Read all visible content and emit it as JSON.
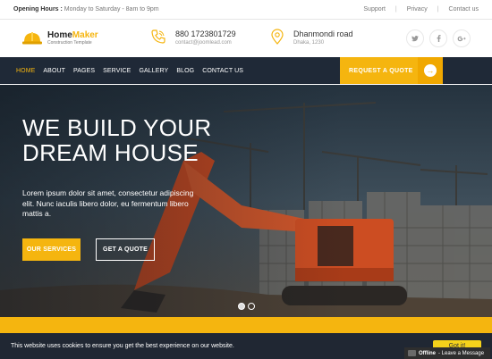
{
  "topbar": {
    "hours_label": "Opening Hours :",
    "hours_value": "Monday to Saturday - 8am to 9pm",
    "links": [
      "Support",
      "Privacy",
      "Contact us"
    ]
  },
  "header": {
    "logo_name_1": "Home",
    "logo_name_2": "Maker",
    "logo_tagline": "Construction Template",
    "phone": "880 1723801729",
    "email": "contact@joomlead.com",
    "address_line1": "Dhanmondi road",
    "address_line2": "Dhaka, 1230",
    "social": [
      "twitter-icon",
      "facebook-icon",
      "google-plus-icon"
    ]
  },
  "nav": {
    "items": [
      "HOME",
      "ABOUT",
      "PAGES",
      "SERVICE",
      "GALLERY",
      "BLOG",
      "CONTACT US"
    ],
    "cta": "REQUEST A QUOTE"
  },
  "hero": {
    "title_line1": "WE BUILD YOUR",
    "title_line2": "DREAM HOUSE",
    "text": "Lorem ipsum dolor sit amet, consectetur adipiscing elit. Nunc iaculis libero dolor, eu fermentum libero mattis a.",
    "btn_primary": "OUR SERVICES",
    "btn_secondary": "GET A QUOTE",
    "slides": 2,
    "active_slide": 1
  },
  "cookie": {
    "text": "This website uses cookies to ensure you get the best experience on our website.",
    "button": "Got it!"
  },
  "chat": {
    "status": "Offline",
    "text": "- Leave a Message"
  },
  "colors": {
    "accent": "#f5b50f",
    "nav_bg": "#1f2937",
    "cookie_bg": "#202733"
  }
}
